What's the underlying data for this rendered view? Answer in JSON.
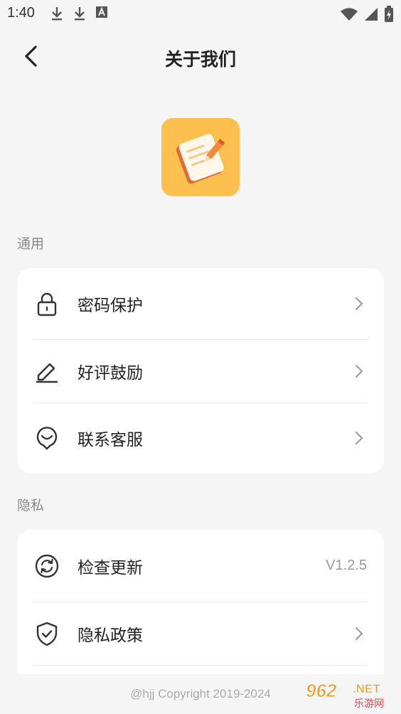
{
  "status_bar": {
    "time": "1:40",
    "left_icons": [
      "download-icon",
      "download-icon",
      "font-notification-icon"
    ],
    "right_icons": [
      "wifi-icon",
      "signal-icon",
      "battery-charging-icon"
    ]
  },
  "header": {
    "title": "关于我们",
    "back_icon": "chevron-left-icon"
  },
  "app_logo": {
    "icon": "notepad-pencil-icon",
    "bg_color": "#fdc04f"
  },
  "sections": [
    {
      "label": "通用",
      "items": [
        {
          "label": "密码保护",
          "icon": "lock-icon"
        },
        {
          "label": "好评鼓励",
          "icon": "pencil-icon"
        },
        {
          "label": "联系客服",
          "icon": "smile-chat-icon"
        }
      ]
    },
    {
      "label": "隐私",
      "items": [
        {
          "label": "检查更新",
          "icon": "refresh-icon",
          "value": "V1.2.5"
        },
        {
          "label": "隐私政策",
          "icon": "shield-check-icon"
        }
      ]
    }
  ],
  "footer": {
    "copyright": "@hjj Copyright 2019-2024"
  },
  "watermark": {
    "brand_number": "962",
    "brand_suffix": ".NET",
    "brand_subtitle": "乐游网"
  }
}
